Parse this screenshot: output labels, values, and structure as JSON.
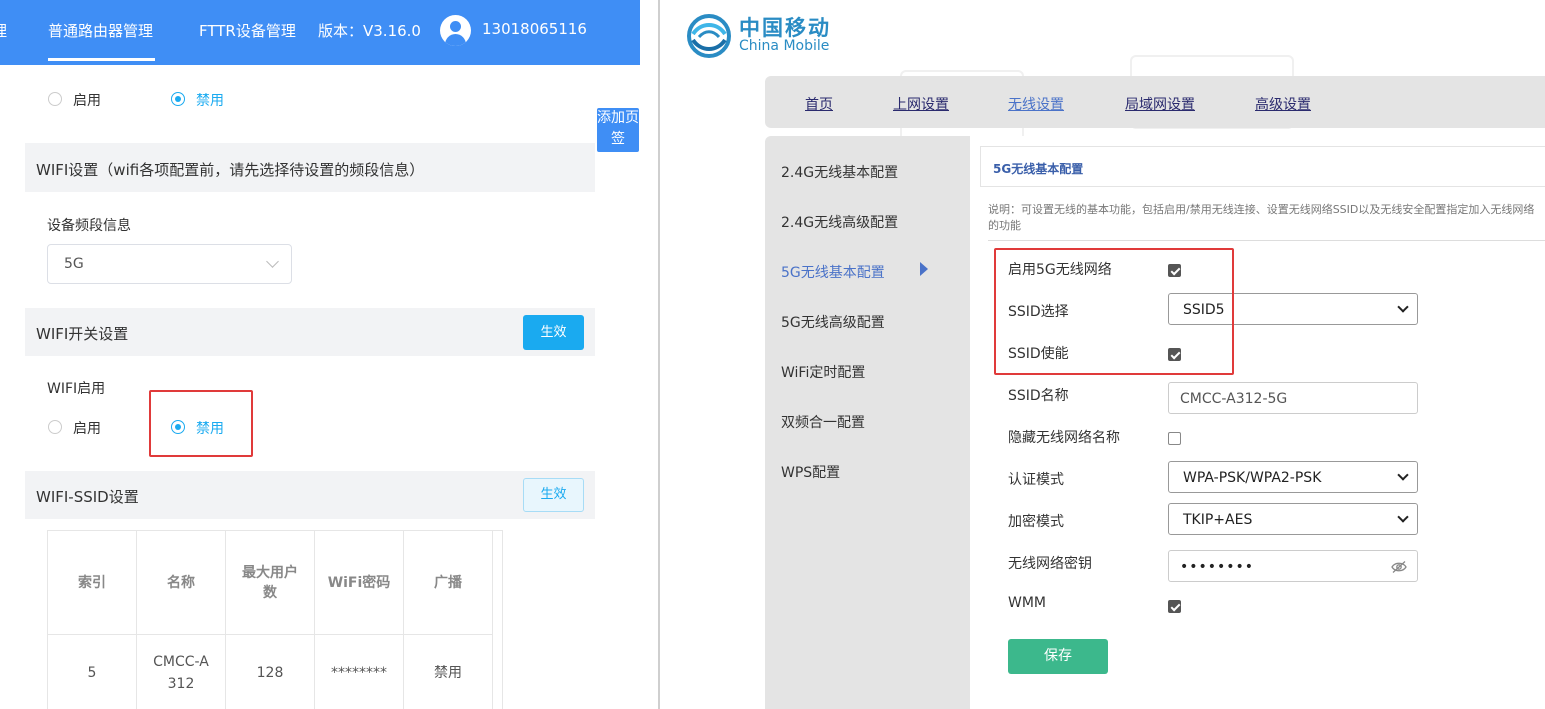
{
  "left": {
    "topbar": {
      "edge_char": "理",
      "tab1": "普通路由器管理",
      "tab2": "FTTR设备管理",
      "version": "版本：V3.16.0",
      "phone": "13018065116"
    },
    "top_radio": {
      "enable": "启用",
      "disable": "禁用"
    },
    "wifi_settings_title": "WIFI设置（wifi各项配置前，请先选择待设置的频段信息）",
    "band_label": "设备频段信息",
    "band_value": "5G",
    "switch_title": "WIFI开关设置",
    "apply_label": "生效",
    "wifi_enable_label": "WIFI启用",
    "wifi_radio": {
      "enable": "启用",
      "disable": "禁用"
    },
    "ssid_title": "WIFI-SSID设置",
    "ssid_apply_label": "生效",
    "table": {
      "headers": [
        "索引",
        "名称",
        "最大用户数",
        "WiFi密码",
        "广播"
      ],
      "row": [
        "5",
        "CMCC-A312",
        "128",
        "********",
        "禁用"
      ]
    },
    "add_tag": "添加页签"
  },
  "right": {
    "logo_cn": "中国移动",
    "logo_en": "China Mobile",
    "nav": [
      "首页",
      "上网设置",
      "无线设置",
      "局域网设置",
      "高级设置"
    ],
    "nav_active": "无线设置",
    "sidebar": [
      "2.4G无线基本配置",
      "2.4G无线高级配置",
      "5G无线基本配置",
      "5G无线高级配置",
      "WiFi定时配置",
      "双频合一配置",
      "WPS配置"
    ],
    "sidebar_active": "5G无线基本配置",
    "panel_title": "5G无线基本配置",
    "description": "说明：可设置无线的基本功能，包括启用/禁用无线连接、设置无线网络SSID以及无线安全配置指定加入无线网络的功能",
    "form": {
      "enable_5g_label": "启用5G无线网络",
      "enable_5g_checked": true,
      "ssid_select_label": "SSID选择",
      "ssid_select_value": "SSID5",
      "ssid_enable_label": "SSID使能",
      "ssid_enable_checked": true,
      "ssid_name_label": "SSID名称",
      "ssid_name_value": "CMCC-A312-5G",
      "hide_ssid_label": "隐藏无线网络名称",
      "hide_ssid_checked": false,
      "auth_mode_label": "认证模式",
      "auth_mode_value": "WPA-PSK/WPA2-PSK",
      "encrypt_mode_label": "加密模式",
      "encrypt_mode_value": "TKIP+AES",
      "wifi_key_label": "无线网络密钥",
      "wifi_key_value": "••••••••",
      "wmm_label": "WMM",
      "wmm_checked": true,
      "save_label": "保存"
    }
  },
  "colors": {
    "topbar_blue": "#3f8ef5",
    "accent_cyan": "#1aaaf0",
    "highlight_red": "#e03a3a",
    "save_green": "#3cb88c",
    "brand_blue": "#2a8cc4"
  },
  "icons": [
    "user-avatar-icon",
    "chevron-down-icon",
    "eye-off-icon",
    "china-mobile-logo",
    "caret-right-icon",
    "check-icon"
  ]
}
